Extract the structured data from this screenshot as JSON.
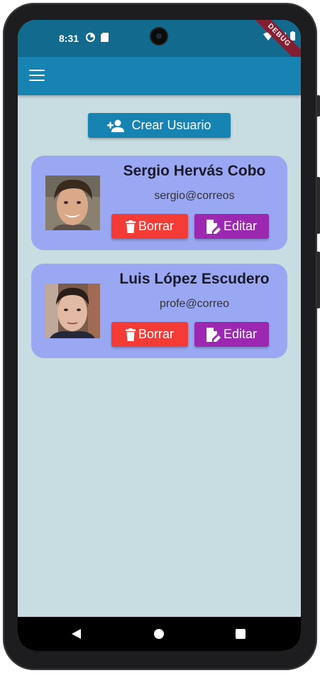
{
  "status_bar": {
    "time": "8:31",
    "debug_label": "DEBUG"
  },
  "app_bar": {
    "menu_icon": "hamburger-menu-icon"
  },
  "actions": {
    "create_user_label": "Crear Usuario",
    "create_user_icon": "person-add-icon"
  },
  "users": [
    {
      "name": "Sergio Hervás Cobo",
      "email": "sergio@correos",
      "delete_label": "Borrar",
      "edit_label": "Editar"
    },
    {
      "name": "Luis López Escudero",
      "email": "profe@correo",
      "delete_label": "Borrar",
      "edit_label": "Editar"
    }
  ],
  "colors": {
    "app_bar": "#1783b3",
    "status_bar": "#126a8e",
    "background": "#c8dde2",
    "card": "#9aa8f3",
    "delete_button": "#f43b36",
    "edit_button": "#9c27b0"
  },
  "nav_bar": {
    "back_icon": "back-triangle-icon",
    "home_icon": "home-circle-icon",
    "recents_icon": "recents-square-icon"
  }
}
